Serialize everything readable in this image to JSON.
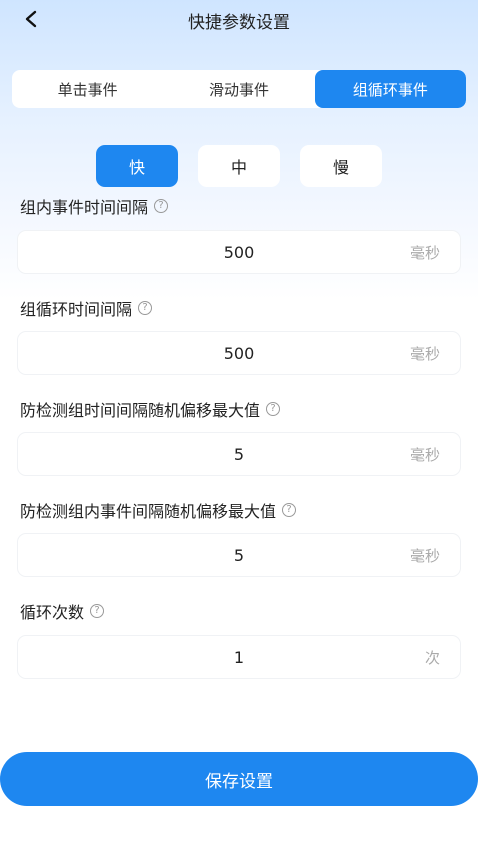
{
  "header": {
    "title": "快捷参数设置"
  },
  "tabs": [
    {
      "label": "单击事件",
      "active": false
    },
    {
      "label": "滑动事件",
      "active": false
    },
    {
      "label": "组循环事件",
      "active": true
    }
  ],
  "speed": [
    {
      "label": "快",
      "active": true
    },
    {
      "label": "中",
      "active": false
    },
    {
      "label": "慢",
      "active": false
    }
  ],
  "fields": [
    {
      "label": "组内事件时间间隔",
      "value": "500",
      "unit": "毫秒"
    },
    {
      "label": "组循环时间间隔",
      "value": "500",
      "unit": "毫秒"
    },
    {
      "label": "防检测组时间间隔随机偏移最大值",
      "value": "5",
      "unit": "毫秒"
    },
    {
      "label": "防检测组内事件间隔随机偏移最大值",
      "value": "5",
      "unit": "毫秒"
    },
    {
      "label": "循环次数",
      "value": "1",
      "unit": "次"
    }
  ],
  "save_button": {
    "label": "保存设置"
  },
  "help_glyph": "?",
  "colors": {
    "accent": "#1e87f0"
  }
}
